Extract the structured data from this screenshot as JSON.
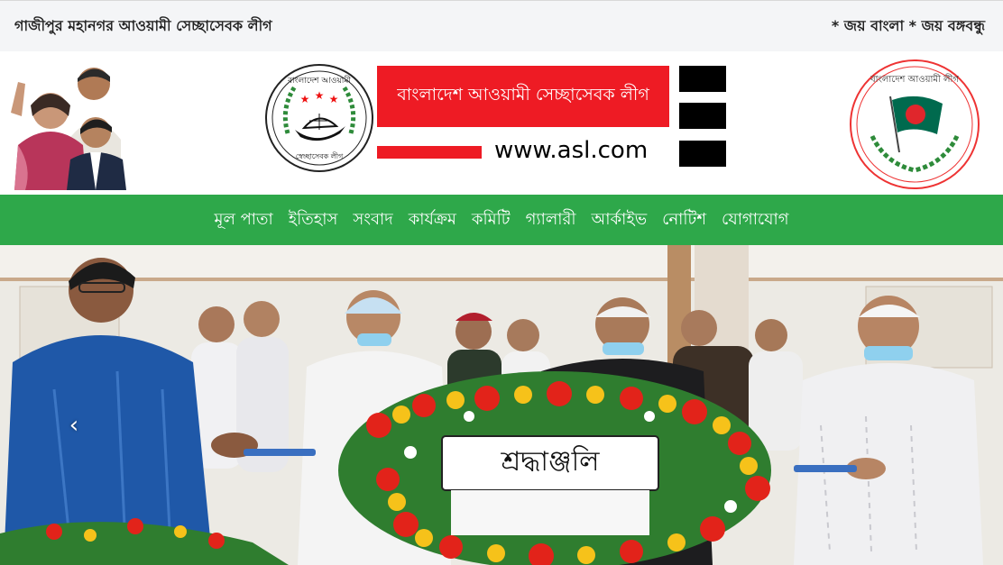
{
  "topbar": {
    "org_name": "গাজীপুর মহানগর আওয়ামী সেচ্ছাসেবক লীগ",
    "slogan": "* জয় বাংলা * জয় বঙ্গবন্ধু"
  },
  "header": {
    "banner_title": "বাংলাদেশ আওয়ামী সেচ্ছাসেবক লীগ",
    "website": "www.asl.com",
    "logo_left_text_top": "বাংলাদেশ আওয়ামী",
    "logo_left_text_bottom": "স্বেচ্ছাসেবক লীগ",
    "logo_right_text": "বাংলাদেশ আওয়ামী লীগ"
  },
  "nav": {
    "items": [
      {
        "label": "মূল পাতা"
      },
      {
        "label": "ইতিহাস"
      },
      {
        "label": "সংবাদ"
      },
      {
        "label": "কার্যক্রম"
      },
      {
        "label": "কমিটি"
      },
      {
        "label": "গ্যালারী"
      },
      {
        "label": "আর্কাইভ"
      },
      {
        "label": "নোটিশ"
      },
      {
        "label": "যোগাযোগ"
      }
    ]
  },
  "slider": {
    "wreath_text": "শ্রদ্ধাঞ্জলি",
    "prev_icon": "chevron-left-icon"
  },
  "colors": {
    "nav_green": "#2ea84a",
    "banner_red": "#ee1b24",
    "topbar_bg": "#f4f5f7"
  }
}
